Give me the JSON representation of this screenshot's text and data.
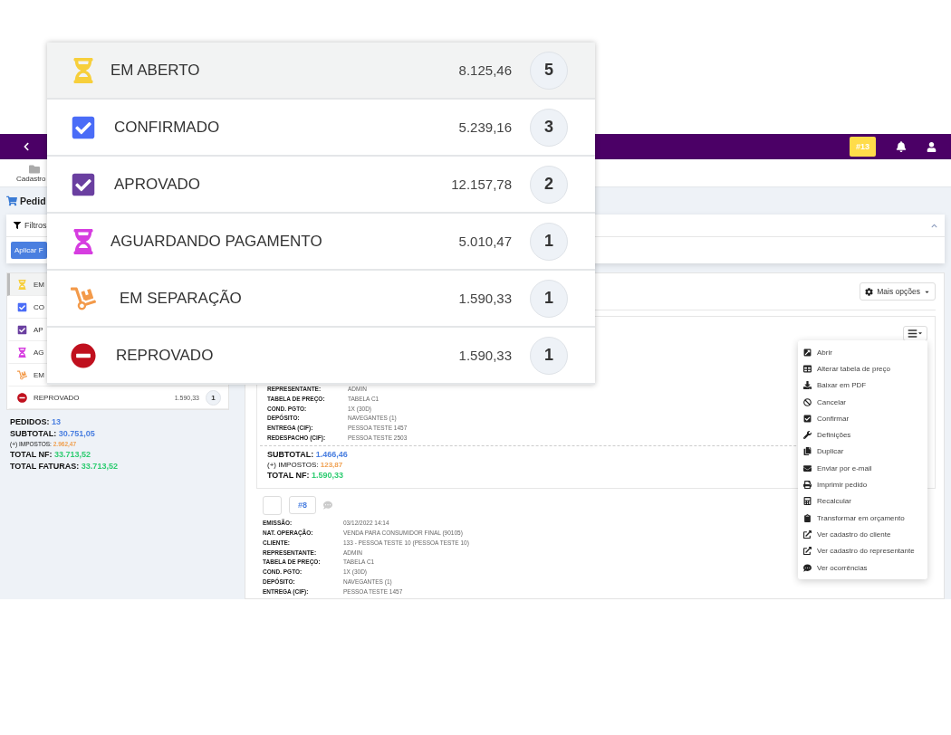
{
  "navbar": {
    "badge": "#13"
  },
  "toolbar": {
    "label": "Cadastro"
  },
  "page_title": "Pedid",
  "filters": {
    "title": "Filtros",
    "button": "Aplicar F"
  },
  "status_list": [
    {
      "kind": "open",
      "label": "EM",
      "selected": true
    },
    {
      "kind": "confirmed",
      "label": "CO",
      "selected": false
    },
    {
      "kind": "approved",
      "label": "AP",
      "selected": false
    },
    {
      "kind": "awaiting",
      "label": "AG",
      "selected": false
    },
    {
      "kind": "picking",
      "label": "EM",
      "selected": false
    },
    {
      "kind": "rejected",
      "label": "REPROVADO",
      "value": "1.590,33",
      "count": "1",
      "selected": false
    }
  ],
  "totals": [
    {
      "kind": "main",
      "label": "PEDIDOS:",
      "value": "13",
      "color": "#4a7fe0"
    },
    {
      "kind": "main",
      "label": "SUBTOTAL:",
      "value": "30.751,05",
      "color": "#4a7fe0"
    },
    {
      "kind": "minor",
      "label": "(+) IMPOSTOS:",
      "value": "2.962,47",
      "color": "#f0a050"
    },
    {
      "kind": "main",
      "label": "TOTAL NF:",
      "value": "33.713,52",
      "color": "#2ecc71"
    },
    {
      "kind": "main",
      "label": "TOTAL FATURAS:",
      "value": "33.713,52",
      "color": "#2ecc71"
    }
  ],
  "results": {
    "more_options": "Mais opções",
    "orders": [
      {
        "fields": [
          {
            "label": "REPRESENTANTE:",
            "value": "ADMIN"
          },
          {
            "label": "TABELA DE PREÇO:",
            "value": "TABELA C1"
          },
          {
            "label": "COND. PGTO:",
            "value": "1X (30D)"
          },
          {
            "label": "DEPÓSITO:",
            "value": "NAVEGANTES (1)"
          },
          {
            "label": "ENTREGA (CIF):",
            "value": "PESSOA TESTE 1457"
          },
          {
            "label": "REDESPACHO (CIF):",
            "value": "PESSOA TESTE 2503"
          }
        ],
        "summary": [
          {
            "kind": "main",
            "label": "SUBTOTAL:",
            "value": "1.466,46",
            "color": "#4a7fe0"
          },
          {
            "kind": "minor",
            "label": "(+) IMPOSTOS:",
            "value": "123,87",
            "color": "#f0a050"
          },
          {
            "kind": "main",
            "label": "TOTAL NF:",
            "value": "1.590,33",
            "color": "#2ecc71"
          }
        ],
        "menu": [
          {
            "kind": "open",
            "label": "Abrir"
          },
          {
            "kind": "table",
            "label": "Alterar tabela de preço"
          },
          {
            "kind": "download",
            "label": "Baixar em PDF"
          },
          {
            "kind": "cancel",
            "label": "Cancelar"
          },
          {
            "kind": "confirm",
            "label": "Confirmar"
          },
          {
            "kind": "settings",
            "label": "Definições"
          },
          {
            "kind": "duplicate",
            "label": "Duplicar"
          },
          {
            "kind": "email",
            "label": "Enviar por e-mail"
          },
          {
            "kind": "print",
            "label": "Imprimir pedido"
          },
          {
            "kind": "recalc",
            "label": "Recalcular"
          },
          {
            "kind": "convert",
            "label": "Transformar em orçamento"
          },
          {
            "kind": "link",
            "label": "Ver cadastro do cliente"
          },
          {
            "kind": "link",
            "label": "Ver cadastro do representante"
          },
          {
            "kind": "comments",
            "label": "Ver ocorrências"
          }
        ]
      },
      {
        "number": "#8",
        "checked": false,
        "fields": [
          {
            "label": "EMISSÃO:",
            "value": "03/12/2022 14:14"
          },
          {
            "label": "NAT. OPERAÇÃO:",
            "value": "VENDA PARA CONSUMIDOR FINAL (90105)"
          },
          {
            "label": "CLIENTE:",
            "value": "133 - PESSOA TESTE 10 (PESSOA TESTE 10)"
          },
          {
            "label": "REPRESENTANTE:",
            "value": "ADMIN"
          },
          {
            "label": "TABELA DE PREÇO:",
            "value": "TABELA C1"
          },
          {
            "label": "COND. PGTO:",
            "value": "1X (30D)"
          },
          {
            "label": "DEPÓSITO:",
            "value": "NAVEGANTES (1)"
          },
          {
            "label": "ENTREGA (CIF):",
            "value": "PESSOA TESTE 1457"
          }
        ]
      }
    ]
  },
  "zoom_panel": {
    "rows": [
      {
        "kind": "open",
        "label": "EM ABERTO",
        "value": "8.125,46",
        "count": "5",
        "selected": true
      },
      {
        "kind": "confirmed",
        "label": "CONFIRMADO",
        "value": "5.239,16",
        "count": "3",
        "selected": false
      },
      {
        "kind": "approved",
        "label": "APROVADO",
        "value": "12.157,78",
        "count": "2",
        "selected": false
      },
      {
        "kind": "awaiting",
        "label": "AGUARDANDO PAGAMENTO",
        "value": "5.010,47",
        "count": "1",
        "selected": false
      },
      {
        "kind": "picking",
        "label": "EM SEPARAÇÃO",
        "value": "1.590,33",
        "count": "1",
        "selected": false
      },
      {
        "kind": "rejected",
        "label": "REPROVADO",
        "value": "1.590,33",
        "count": "1",
        "selected": false
      }
    ]
  }
}
